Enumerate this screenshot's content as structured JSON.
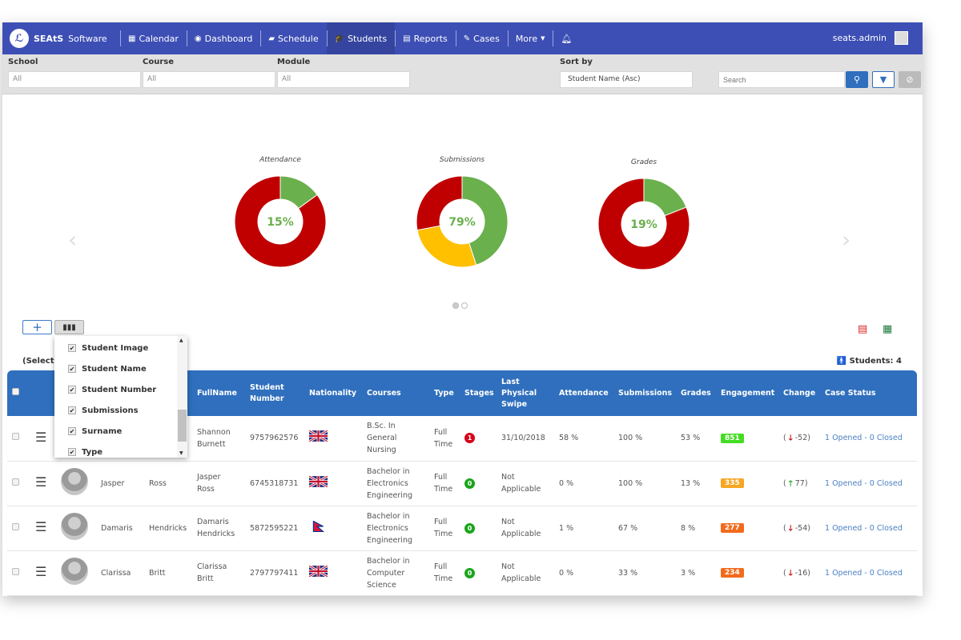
{
  "nav": {
    "brand": "SEAtS",
    "brand_suffix": "Software",
    "items": [
      {
        "label": "Calendar",
        "icon": "calendar-icon"
      },
      {
        "label": "Dashboard",
        "icon": "dashboard-icon"
      },
      {
        "label": "Schedule",
        "icon": "book-icon"
      },
      {
        "label": "Students",
        "icon": "graduation-cap-icon",
        "active": true
      },
      {
        "label": "Reports",
        "icon": "file-icon"
      },
      {
        "label": "Cases",
        "icon": "edit-icon"
      },
      {
        "label": "More",
        "icon": "caret-down-icon"
      }
    ],
    "user": "seats.admin"
  },
  "filters": {
    "school_label": "School",
    "school_value": "All",
    "course_label": "Course",
    "course_value": "All",
    "module_label": "Module",
    "module_value": "All",
    "sort_label": "Sort by",
    "sort_value": "Student Name (Asc)",
    "search_placeholder": "Search"
  },
  "charts": [
    {
      "title": "Attendance",
      "value_label": "15%",
      "segments": [
        {
          "value": 15,
          "color": "#6ab04c"
        },
        {
          "value": 85,
          "color": "#c00000"
        }
      ]
    },
    {
      "title": "Submissions",
      "value_label": "79%",
      "segments": [
        {
          "value": 45,
          "color": "#6ab04c"
        },
        {
          "value": 27,
          "color": "#ffc000"
        },
        {
          "value": 28,
          "color": "#c00000"
        }
      ]
    },
    {
      "title": "Grades",
      "value_label": "19%",
      "segments": [
        {
          "value": 19,
          "color": "#6ab04c"
        },
        {
          "value": 81,
          "color": "#c00000"
        }
      ]
    }
  ],
  "selected_label": "(Selected",
  "students_count": "Students: 4",
  "column_menu": [
    "Student Image",
    "Student Name",
    "Student Number",
    "Submissions",
    "Surname",
    "Type"
  ],
  "table": {
    "headers": [
      "",
      "",
      "",
      "",
      "",
      "FullName",
      "Student Number",
      "Nationality",
      "Courses",
      "Type",
      "Stages",
      "Last Physical Swipe",
      "Attendance",
      "Submissions",
      "Grades",
      "Engagement",
      "Change",
      "Case Status"
    ],
    "rows": [
      {
        "first": "",
        "surname": "",
        "fullname": "Shannon Burnett",
        "number": "9757962576",
        "nationality": "uk",
        "course": "B.Sc. In General Nursing",
        "type": "Full Time",
        "stage": "1",
        "stage_color": "#d9001b",
        "swipe": "31/10/2018",
        "attendance": "58 %",
        "submissions": "100 %",
        "grades": "53 %",
        "engagement": "851",
        "eng_color": "#44dd22",
        "change_dir": "down",
        "change": "-52",
        "case": "1 Opened - 0 Closed"
      },
      {
        "first": "Jasper",
        "surname": "Ross",
        "fullname": "Jasper Ross",
        "number": "6745318731",
        "nationality": "uk",
        "course": "Bachelor in Electronics Engineering",
        "type": "Full Time",
        "stage": "0",
        "stage_color": "#1aa51a",
        "swipe": "Not Applicable",
        "attendance": "0 %",
        "submissions": "100 %",
        "grades": "13 %",
        "engagement": "335",
        "eng_color": "#f5a623",
        "change_dir": "up",
        "change": "77",
        "case": "1 Opened - 0 Closed"
      },
      {
        "first": "Damaris",
        "surname": "Hendricks",
        "fullname": "Damaris Hendricks",
        "number": "5872595221",
        "nationality": "nepal",
        "course": "Bachelor in Electronics Engineering",
        "type": "Full Time",
        "stage": "0",
        "stage_color": "#1aa51a",
        "swipe": "Not Applicable",
        "attendance": "1 %",
        "submissions": "67 %",
        "grades": "8 %",
        "engagement": "277",
        "eng_color": "#f26b1d",
        "change_dir": "down",
        "change": "-54",
        "case": "1 Opened - 0 Closed"
      },
      {
        "first": "Clarissa",
        "surname": "Britt",
        "fullname": "Clarissa Britt",
        "number": "2797797411",
        "nationality": "uk",
        "course": "Bachelor in Computer Science",
        "type": "Full Time",
        "stage": "0",
        "stage_color": "#1aa51a",
        "swipe": "Not Applicable",
        "attendance": "0 %",
        "submissions": "33 %",
        "grades": "3 %",
        "engagement": "234",
        "eng_color": "#f26b1d",
        "change_dir": "down",
        "change": "-16",
        "case": "1 Opened - 0 Closed"
      }
    ]
  }
}
